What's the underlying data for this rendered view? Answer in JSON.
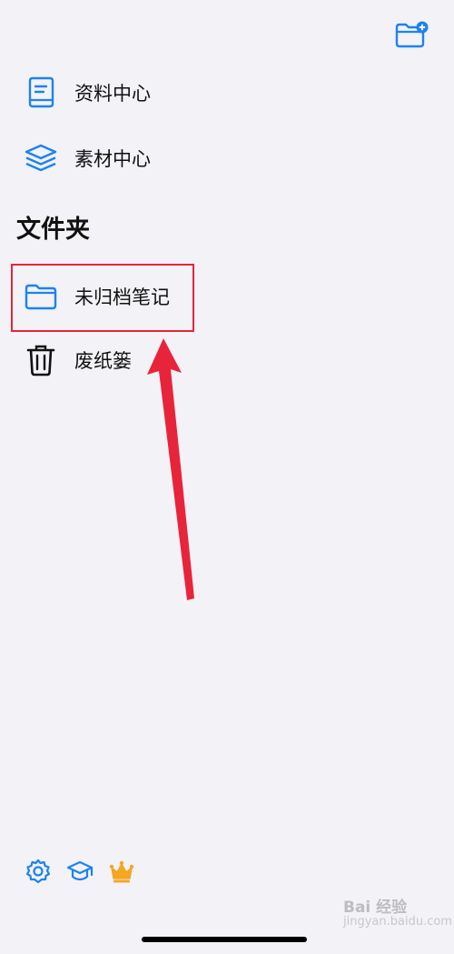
{
  "sidebar": {
    "items": [
      {
        "label": "资料中心",
        "icon": "notebook-icon"
      },
      {
        "label": "素材中心",
        "icon": "layers-icon"
      }
    ]
  },
  "folders": {
    "title": "文件夹",
    "items": [
      {
        "label": "未归档笔记",
        "icon": "folder-icon"
      },
      {
        "label": "废纸篓",
        "icon": "trash-icon"
      }
    ]
  },
  "toolbar": {
    "new_folder_icon": "folder-plus-icon",
    "bottom_icons": [
      "gear-icon",
      "graduation-cap-icon",
      "crown-icon"
    ]
  },
  "colors": {
    "accent": "#1d82f0",
    "highlight": "#e8243a",
    "crown": "#f5a623",
    "background": "#f2f2f7"
  },
  "watermark": {
    "title": "Bai 经验",
    "url": "jingyan.baidu.com"
  }
}
